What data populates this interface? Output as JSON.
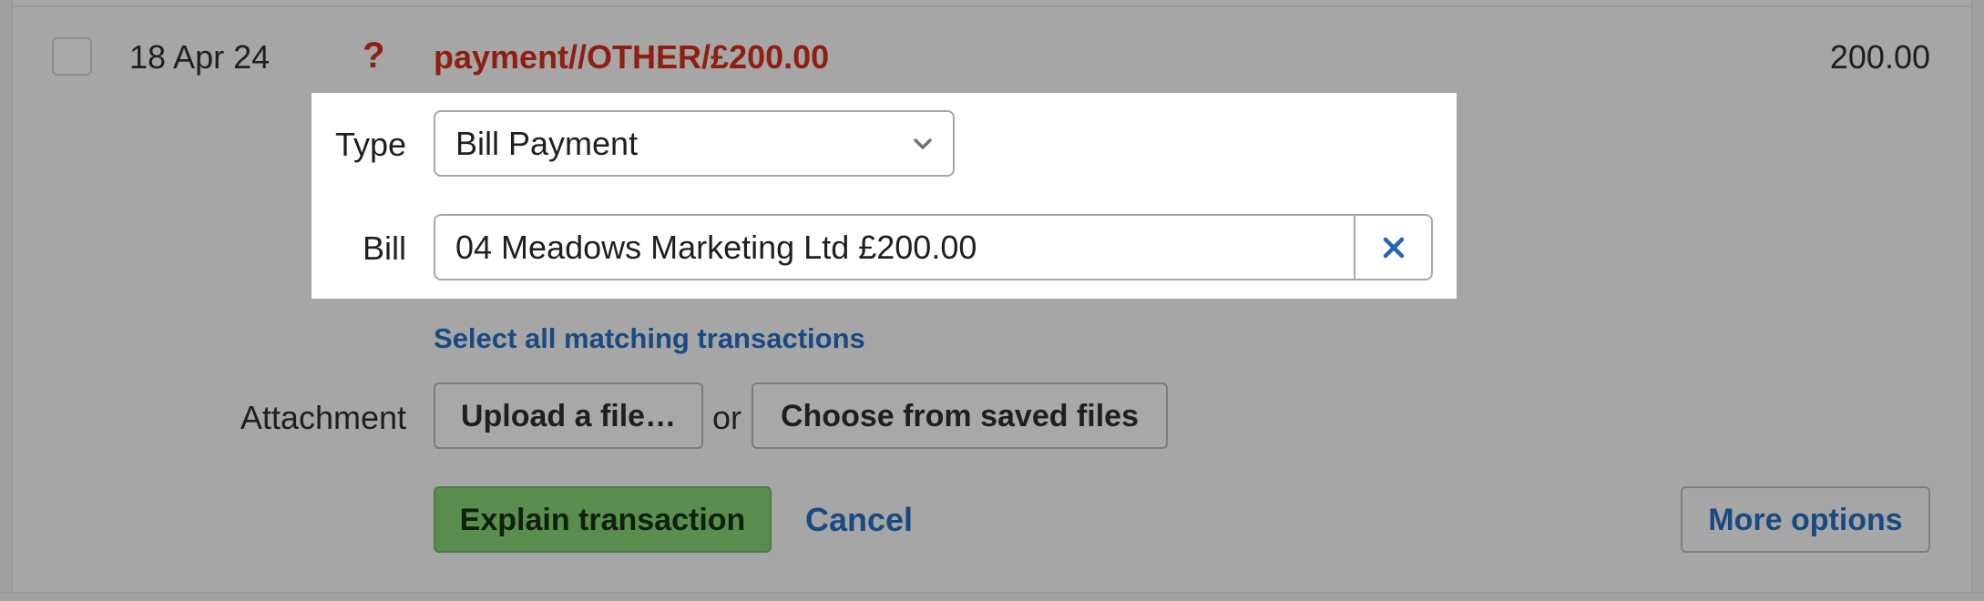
{
  "transaction": {
    "date": "18 Apr 24",
    "status_icon": "?",
    "description": "payment//OTHER/£200.00",
    "amount": "200.00",
    "description_color": "#8e1f12"
  },
  "form": {
    "type_label": "Type",
    "type_value": "Bill Payment",
    "bill_label": "Bill",
    "bill_value": "04 Meadows Marketing Ltd £200.00",
    "select_all_link": "Select all matching transactions",
    "attachment_label": "Attachment",
    "upload_button": "Upload a file…",
    "or_text": "or",
    "choose_button": "Choose from saved files",
    "explain_button": "Explain transaction",
    "cancel_link": "Cancel",
    "more_options_button": "More options"
  },
  "icons": {
    "type_dropdown": "chevron-down-icon",
    "bill_clear": "close-icon"
  },
  "colors": {
    "primary_button": "#5a8e4f",
    "link": "#1a4a82",
    "overlay": "#a6a6a6"
  }
}
